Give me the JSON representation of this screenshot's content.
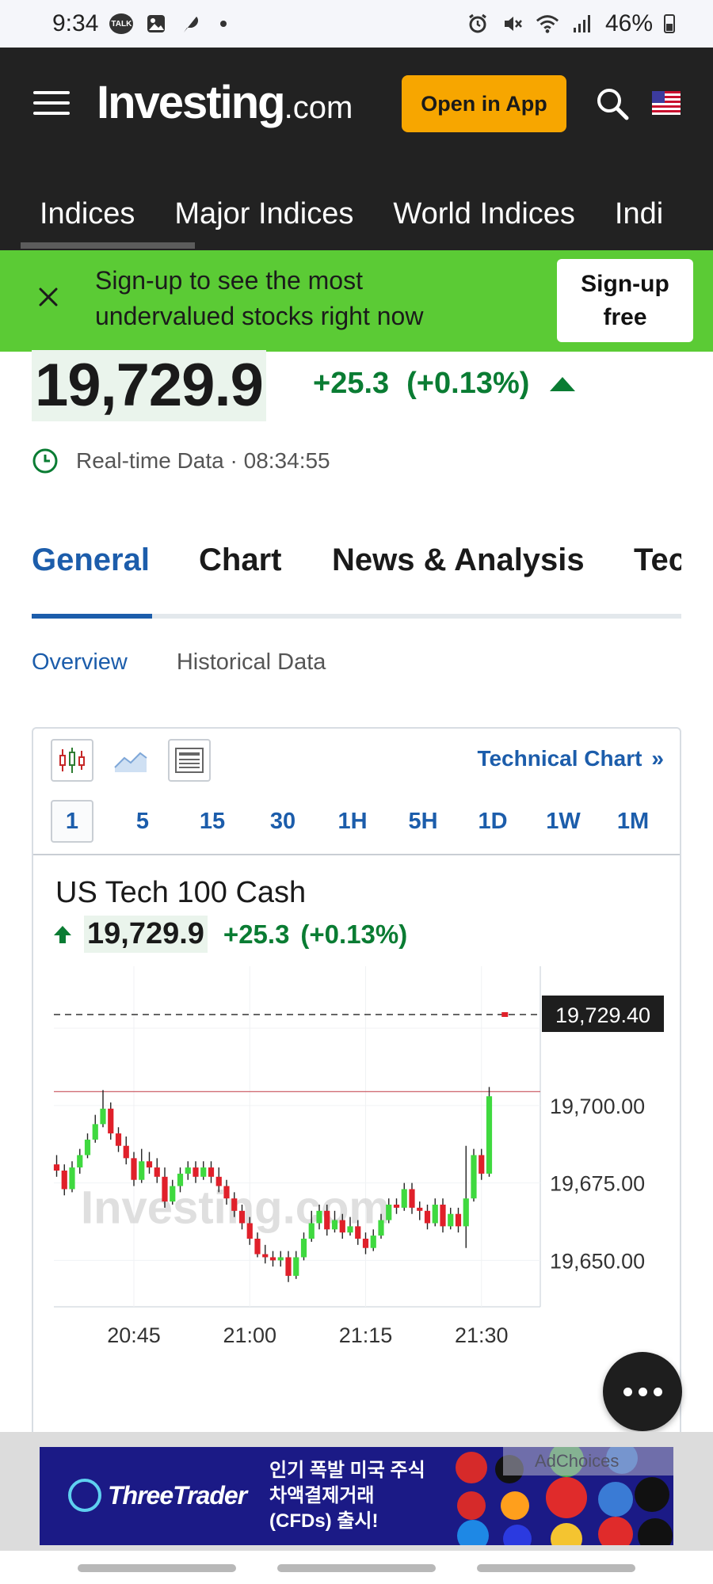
{
  "status_bar": {
    "time": "9:34",
    "battery": "46%",
    "icons": [
      "talk-icon",
      "gallery-icon",
      "feather-icon",
      "alarm-icon",
      "mute-icon",
      "wifi-icon",
      "signal-icon",
      "battery-icon"
    ]
  },
  "header": {
    "logo_main": "Investing",
    "logo_suffix": ".com",
    "open_app_label": "Open in App",
    "nav_tabs": [
      "Indices",
      "Major Indices",
      "World Indices",
      "Indi"
    ]
  },
  "banner": {
    "text": "Sign-up to see the most undervalued stocks right now",
    "button_line1": "Sign-up",
    "button_line2": "free"
  },
  "quote": {
    "price": "19,729.9",
    "change": "+25.3",
    "change_pct": "(+0.13%)",
    "realtime_label": "Real-time Data",
    "time": "· 08:34:55"
  },
  "content_tabs": [
    "General",
    "Chart",
    "News & Analysis",
    "Tec"
  ],
  "sub_tabs": [
    "Overview",
    "Historical Data"
  ],
  "chart_card": {
    "technical_chart_label": "Technical Chart",
    "technical_chart_chevron": "»",
    "timeframes": [
      "1",
      "5",
      "15",
      "30",
      "1H",
      "5H",
      "1D",
      "1W",
      "1M"
    ],
    "active_timeframe": "1"
  },
  "colors": {
    "header_bg": "#222222",
    "accent_orange": "#f7a600",
    "banner_green": "#5bcb35",
    "positive_green": "#0a7c33",
    "link_blue": "#1c5dab",
    "candle_up": "#3fd93f",
    "candle_down": "#e0202a"
  },
  "chart_data": {
    "type": "candlestick",
    "title": "US Tech 100 Cash",
    "price": "19,729.9",
    "change": "+25.3",
    "change_pct": "(+0.13%)",
    "watermark": "Investing.com",
    "x_tick_labels": [
      "20:45",
      "21:00",
      "21:15",
      "21:30"
    ],
    "x_tick_minutes": [
      0,
      15,
      30,
      45
    ],
    "y_tick_labels": [
      "19,650.00",
      "19,675.00",
      "19,700.00"
    ],
    "y_ticks": [
      19650,
      19675,
      19700
    ],
    "current_price_label": "19,729.40",
    "current_price": 19729.4,
    "high_line": 19704.5,
    "ylim": [
      19635,
      19745
    ],
    "first_candle_minute": -10,
    "candles": [
      [
        19681,
        19679,
        19684,
        19677
      ],
      [
        19679,
        19673,
        19681,
        19671
      ],
      [
        19673,
        19680,
        19682,
        19672
      ],
      [
        19680,
        19684,
        19686,
        19678
      ],
      [
        19684,
        19689,
        19691,
        19683
      ],
      [
        19689,
        19694,
        19697,
        19688
      ],
      [
        19694,
        19699,
        19705,
        19693
      ],
      [
        19699,
        19691,
        19701,
        19689
      ],
      [
        19691,
        19687,
        19693,
        19685
      ],
      [
        19687,
        19683,
        19690,
        19681
      ],
      [
        19683,
        19676,
        19685,
        19674
      ],
      [
        19676,
        19682,
        19686,
        19675
      ],
      [
        19682,
        19680,
        19685,
        19678
      ],
      [
        19680,
        19677,
        19683,
        19675
      ],
      [
        19677,
        19669,
        19680,
        19667
      ],
      [
        19669,
        19674,
        19676,
        19668
      ],
      [
        19674,
        19678,
        19680,
        19672
      ],
      [
        19678,
        19680,
        19682,
        19676
      ],
      [
        19680,
        19677,
        19682,
        19675
      ],
      [
        19677,
        19680,
        19682,
        19676
      ],
      [
        19680,
        19677,
        19682,
        19675
      ],
      [
        19677,
        19674,
        19680,
        19672
      ],
      [
        19674,
        19670,
        19676,
        19668
      ],
      [
        19670,
        19666,
        19672,
        19664
      ],
      [
        19666,
        19662,
        19668,
        19660
      ],
      [
        19662,
        19657,
        19664,
        19655
      ],
      [
        19657,
        19652,
        19659,
        19651
      ],
      [
        19652,
        19651,
        19655,
        19649
      ],
      [
        19651,
        19650,
        19653,
        19648
      ],
      [
        19650,
        19651,
        19653,
        19648
      ],
      [
        19651,
        19645,
        19653,
        19643
      ],
      [
        19645,
        19651,
        19653,
        19644
      ],
      [
        19651,
        19657,
        19659,
        19650
      ],
      [
        19657,
        19662,
        19666,
        19656
      ],
      [
        19662,
        19666,
        19668,
        19660
      ],
      [
        19666,
        19660,
        19668,
        19658
      ],
      [
        19660,
        19663,
        19666,
        19659
      ],
      [
        19663,
        19659,
        19665,
        19657
      ],
      [
        19659,
        19661,
        19664,
        19658
      ],
      [
        19661,
        19657,
        19663,
        19655
      ],
      [
        19657,
        19654,
        19659,
        19652
      ],
      [
        19654,
        19658,
        19660,
        19653
      ],
      [
        19658,
        19663,
        19665,
        19657
      ],
      [
        19663,
        19668,
        19670,
        19662
      ],
      [
        19668,
        19667,
        19670,
        19665
      ],
      [
        19667,
        19673,
        19675,
        19666
      ],
      [
        19673,
        19667,
        19675,
        19665
      ],
      [
        19667,
        19666,
        19669,
        19663
      ],
      [
        19666,
        19662,
        19668,
        19660
      ],
      [
        19662,
        19668,
        19670,
        19661
      ],
      [
        19668,
        19661,
        19670,
        19659
      ],
      [
        19661,
        19665,
        19667,
        19660
      ],
      [
        19665,
        19661,
        19667,
        19659
      ],
      [
        19661,
        19670,
        19687,
        19654
      ],
      [
        19670,
        19684,
        19686,
        19669
      ],
      [
        19684,
        19678,
        19686,
        19676
      ],
      [
        19678,
        19703,
        19706,
        19677
      ]
    ],
    "last_tick_price": 19729.4
  },
  "ad": {
    "brand": "ThreeTrader",
    "line1": "인기 폭발 미국 주식",
    "line2": "차액결제거래",
    "line3": "(CFDs) 출시!",
    "adchoices_label": "AdChoices"
  }
}
